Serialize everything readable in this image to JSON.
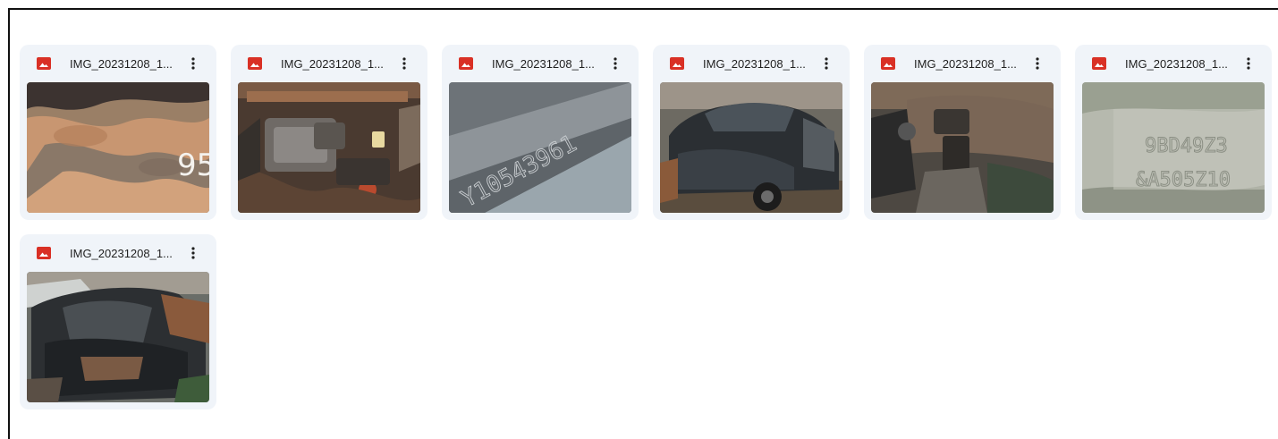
{
  "files": [
    {
      "name": "IMG_20231208_1...",
      "thumb": "rusty-metal-closeup",
      "icon": "image-icon"
    },
    {
      "name": "IMG_20231208_1...",
      "thumb": "engine-bay",
      "icon": "image-icon"
    },
    {
      "name": "IMG_20231208_1...",
      "thumb": "vin-stamp-plate",
      "icon": "image-icon"
    },
    {
      "name": "IMG_20231208_1...",
      "thumb": "wrecked-car-side",
      "icon": "image-icon"
    },
    {
      "name": "IMG_20231208_1...",
      "thumb": "car-interior-dashboard",
      "icon": "image-icon"
    },
    {
      "name": "IMG_20231208_1...",
      "thumb": "engraved-number-plate",
      "icon": "image-icon"
    },
    {
      "name": "IMG_20231208_1...",
      "thumb": "wrecked-car-rear",
      "icon": "image-icon"
    }
  ],
  "thumb_text": {
    "t0": "95",
    "t2": "Y10543961",
    "t5a": "9BD49Z3",
    "t5b": "&A505Z10"
  },
  "colors": {
    "card_bg": "#f0f4f9",
    "icon_red": "#d93025",
    "text": "#1f1f1f"
  }
}
